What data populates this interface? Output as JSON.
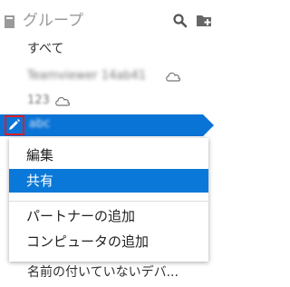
{
  "header": {
    "title": "グループ",
    "icon": "book-icon",
    "search_icon": "search-icon",
    "add_folder_icon": "folder-plus-icon"
  },
  "groups": {
    "all_label": "すべて",
    "item2_blurred": "Teamviewer 14ab41",
    "item3_label": "123",
    "selected_blurred": "abc",
    "cloud_icon": "cloud-icon",
    "edit_icon": "pencil-icon"
  },
  "context_menu": {
    "edit_label": "編集",
    "share_label": "共有",
    "add_partner_label": "パートナーの追加",
    "add_computer_label": "コンピュータの追加"
  },
  "bottom_item": {
    "label": "名前の付いていないデバ..."
  },
  "colors": {
    "accent": "#0a74d6",
    "highlight": "#0a78d8",
    "focus_outline": "#e11b22"
  }
}
